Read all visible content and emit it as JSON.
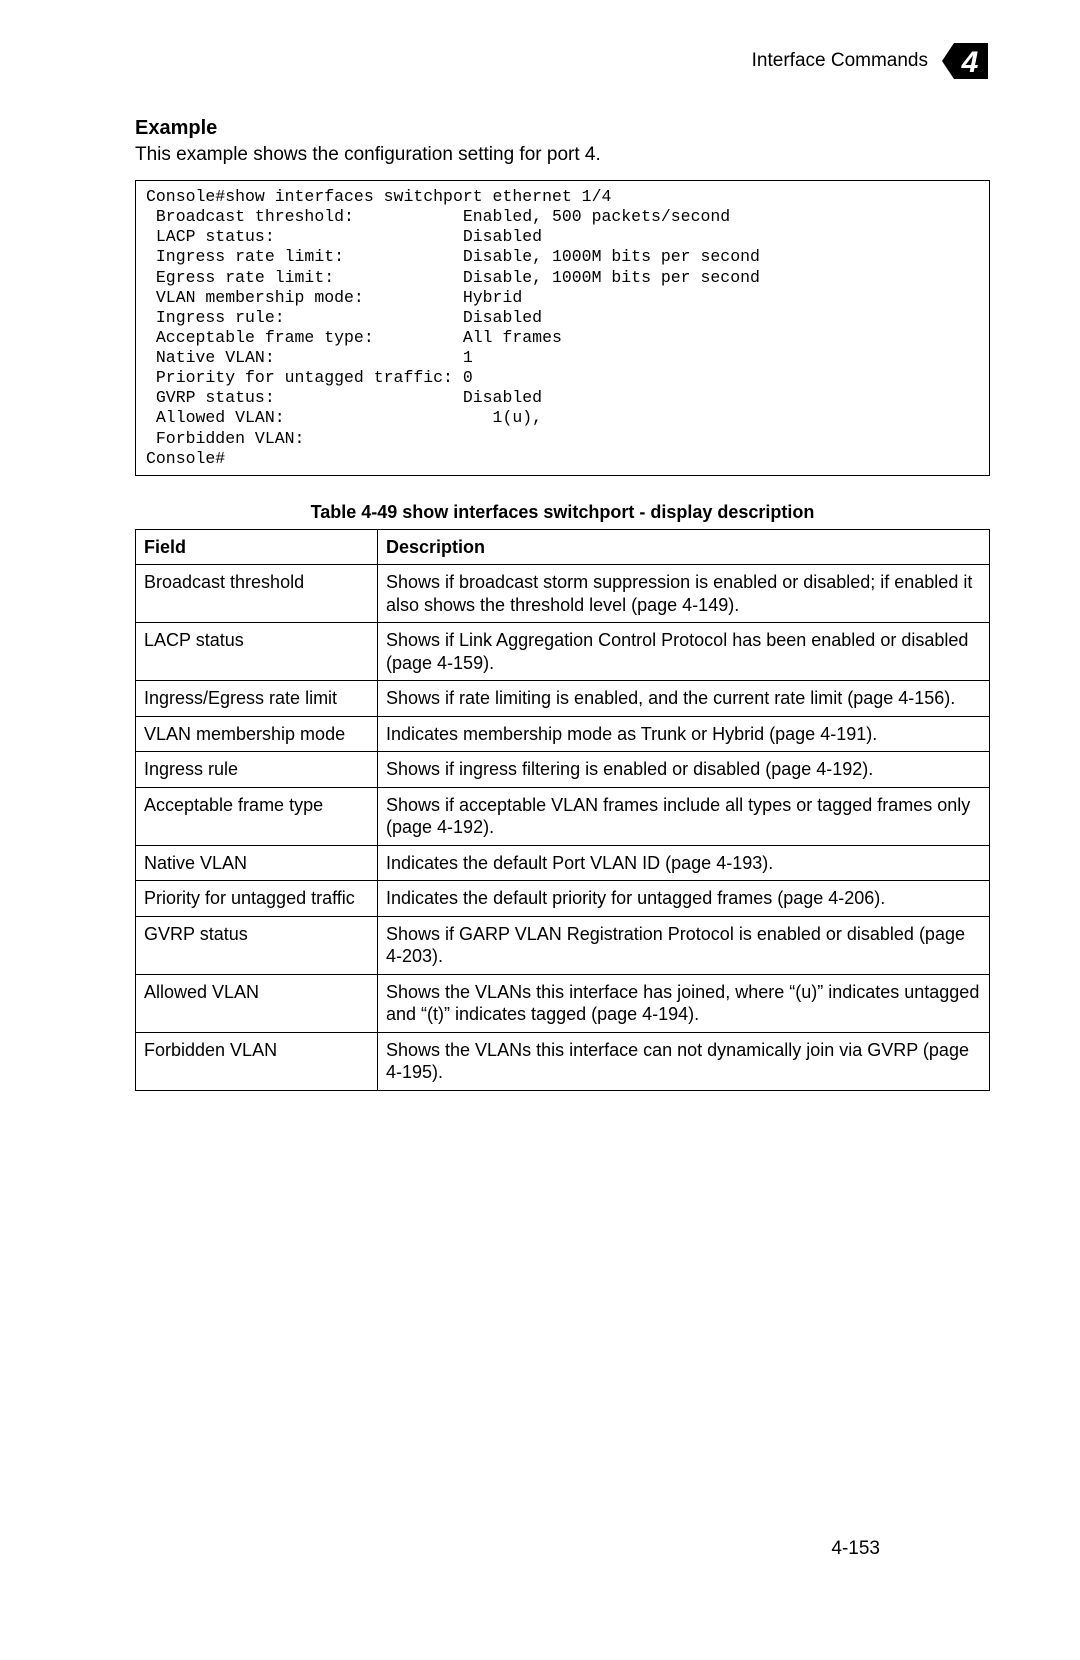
{
  "header": {
    "title": "Interface Commands",
    "chapter_number": "4"
  },
  "section": {
    "heading": "Example",
    "intro": "This example shows the configuration setting for port 4."
  },
  "console_output": "Console#show interfaces switchport ethernet 1/4\n Broadcast threshold:           Enabled, 500 packets/second\n LACP status:                   Disabled\n Ingress rate limit:            Disable, 1000M bits per second\n Egress rate limit:             Disable, 1000M bits per second\n VLAN membership mode:          Hybrid\n Ingress rule:                  Disabled\n Acceptable frame type:         All frames\n Native VLAN:                   1\n Priority for untagged traffic: 0\n GVRP status:                   Disabled\n Allowed VLAN:                     1(u),\n Forbidden VLAN:\nConsole#",
  "table": {
    "caption": "Table 4-49   show interfaces switchport - display description",
    "headers": {
      "field": "Field",
      "description": "Description"
    },
    "rows": [
      {
        "field": "Broadcast threshold",
        "description": "Shows if broadcast storm suppression is enabled or disabled; if enabled it also shows the threshold level (page 4-149)."
      },
      {
        "field": "LACP status",
        "description": "Shows if Link Aggregation Control Protocol has been enabled or disabled (page 4-159)."
      },
      {
        "field": "Ingress/Egress rate limit",
        "description": "Shows if rate limiting is enabled, and the current rate limit (page 4-156)."
      },
      {
        "field": "VLAN membership mode",
        "description": "Indicates membership mode as Trunk or Hybrid (page 4-191)."
      },
      {
        "field": "Ingress rule",
        "description": "Shows if ingress filtering is enabled or disabled (page 4-192)."
      },
      {
        "field": "Acceptable frame type",
        "description": "Shows if acceptable VLAN frames include all types or tagged frames only (page 4-192)."
      },
      {
        "field": "Native VLAN",
        "description": "Indicates the default Port VLAN ID (page 4-193)."
      },
      {
        "field": "Priority for untagged traffic",
        "description": "Indicates the default priority for untagged frames (page 4-206)."
      },
      {
        "field": "GVRP status",
        "description": "Shows if GARP VLAN Registration Protocol is enabled or disabled (page 4-203)."
      },
      {
        "field": "Allowed VLAN",
        "description": "Shows the VLANs this interface has joined, where “(u)” indicates untagged and “(t)” indicates tagged (page 4-194)."
      },
      {
        "field": "Forbidden VLAN",
        "description": "Shows the VLANs this interface can not dynamically join via GVRP (page 4-195)."
      }
    ]
  },
  "page_number": "4-153"
}
